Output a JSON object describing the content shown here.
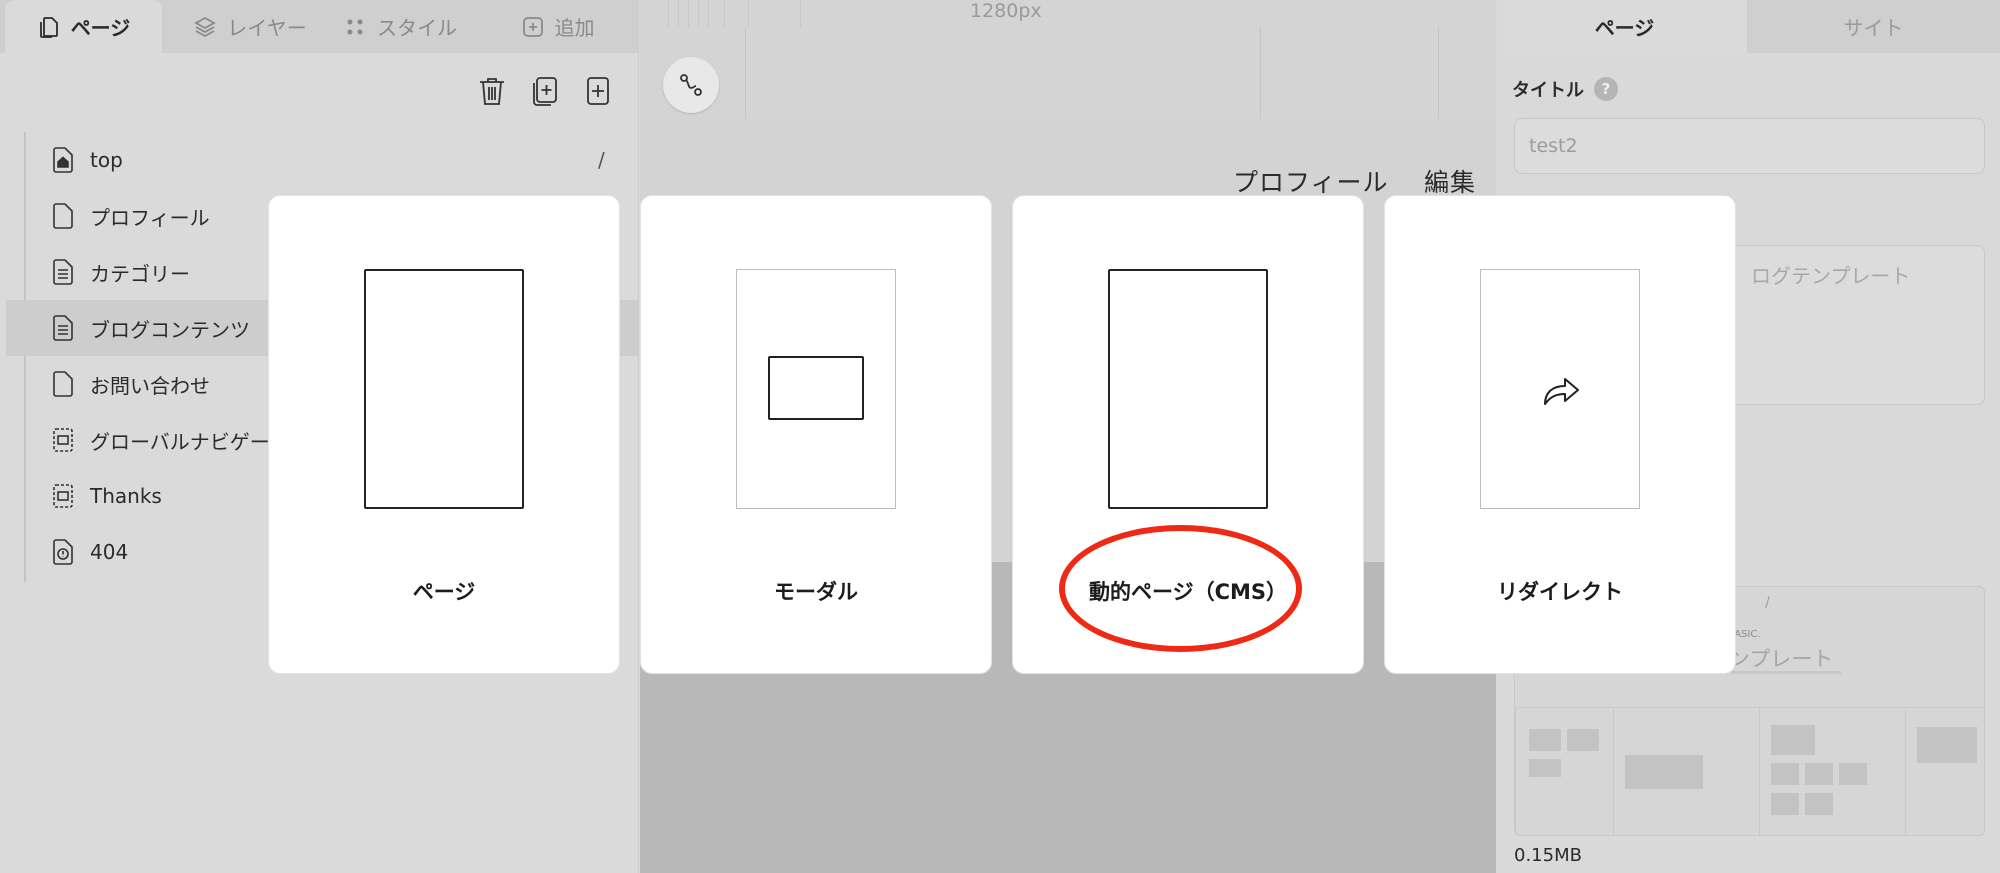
{
  "left_tabs": [
    {
      "label": "ページ",
      "icon": "pages-icon"
    },
    {
      "label": "レイヤー",
      "icon": "layers-icon"
    },
    {
      "label": "スタイル",
      "icon": "style-dots-icon"
    },
    {
      "label": "追加",
      "icon": "plus-square-icon"
    }
  ],
  "pages": [
    {
      "name": "top",
      "icon": "home-page-icon",
      "slug": "/"
    },
    {
      "name": "プロフィール",
      "icon": "blank-page-icon"
    },
    {
      "name": "カテゴリー",
      "icon": "text-page-icon"
    },
    {
      "name": "ブログコンテンツ",
      "icon": "text-page-icon"
    },
    {
      "name": "お問い合わせ",
      "icon": "blank-page-icon"
    },
    {
      "name": "グローバルナビゲー",
      "icon": "component-icon"
    },
    {
      "name": "Thanks",
      "icon": "component-icon"
    },
    {
      "name": "404",
      "icon": "error-page-icon"
    }
  ],
  "canvas": {
    "ruler_label": "1280px",
    "nav_links": [
      "プロフィール",
      "編集者"
    ]
  },
  "right_tabs": [
    {
      "label": "ページ"
    },
    {
      "label": "サイト"
    }
  ],
  "page_settings": {
    "title_label": "タイトル",
    "help_label": "?",
    "title_value": "test2",
    "description_text": "ログテンプレート",
    "thumbnail_slash": "/",
    "thumbnail_basic": "e BASIC.",
    "thumbnail_text": "ンプレート",
    "file_size": "0.15MB"
  },
  "page_types": [
    {
      "label": "ページ",
      "kind": "page"
    },
    {
      "label": "モーダル",
      "kind": "modal"
    },
    {
      "label": "動的ページ（CMS）",
      "kind": "dynamic"
    },
    {
      "label": "リダイレクト",
      "kind": "redirect"
    }
  ],
  "colors": {
    "highlight": "#ee2a14",
    "card_bg": "#ffffff",
    "overlay_bg": "#d8d8d8"
  }
}
